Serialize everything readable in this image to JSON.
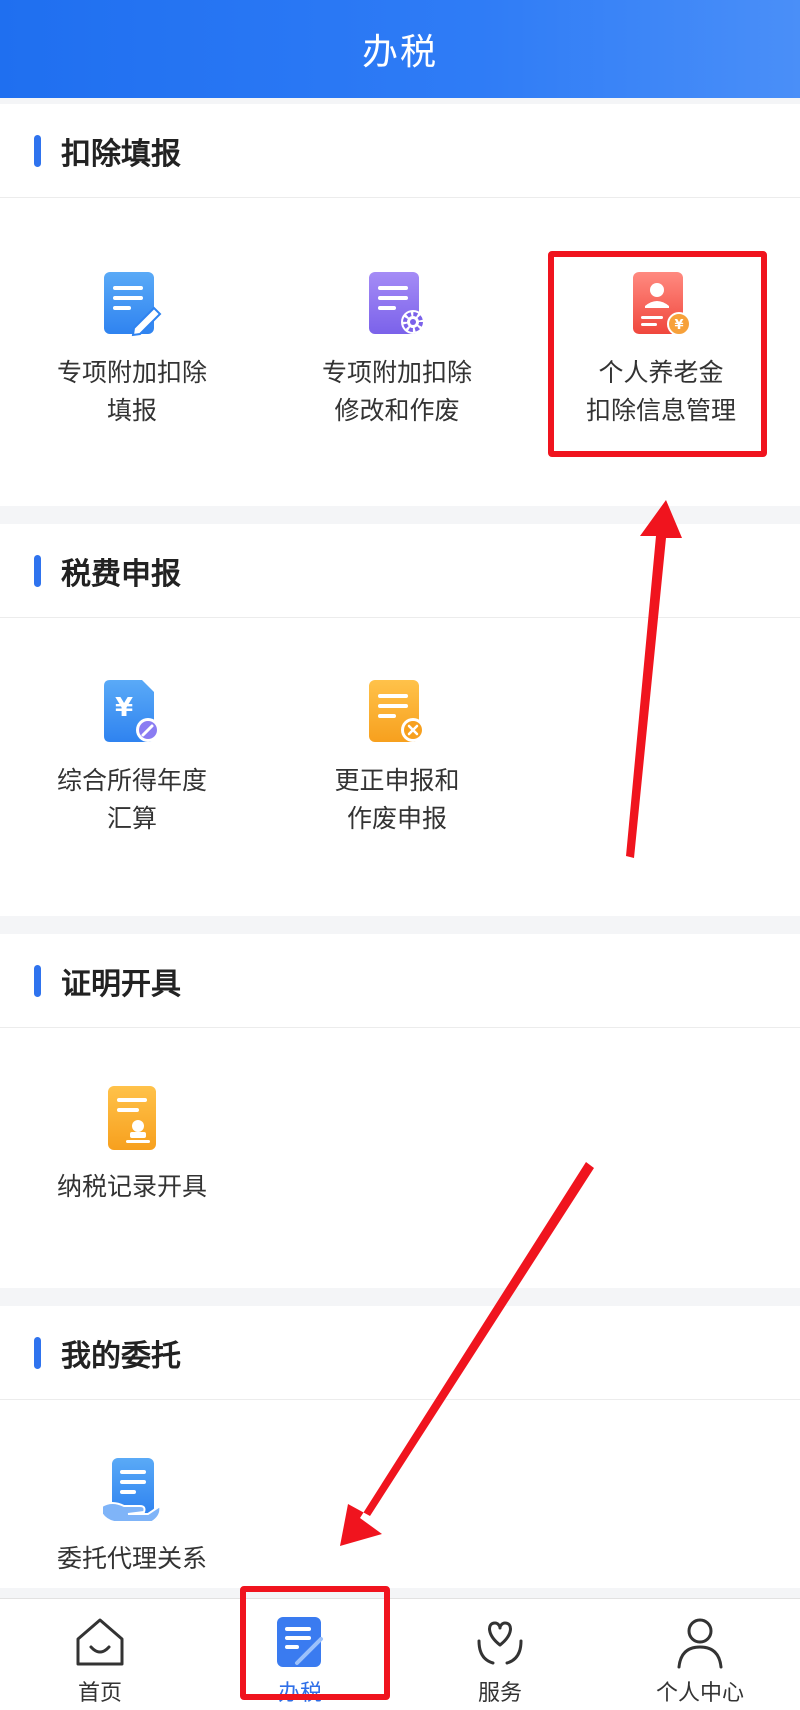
{
  "header": {
    "title": "办税"
  },
  "sections": [
    {
      "title": "扣除填报",
      "items": [
        {
          "label": "专项附加扣除\n填报",
          "icon": "doc-edit-icon"
        },
        {
          "label": "专项附加扣除\n修改和作废",
          "icon": "doc-gear-icon"
        },
        {
          "label": "个人养老金\n扣除信息管理",
          "icon": "pension-card-icon"
        }
      ]
    },
    {
      "title": "税费申报",
      "items": [
        {
          "label": "综合所得年度\n汇算",
          "icon": "yuan-doc-edit-icon"
        },
        {
          "label": "更正申报和\n作废申报",
          "icon": "doc-cancel-icon"
        }
      ]
    },
    {
      "title": "证明开具",
      "items": [
        {
          "label": "纳税记录开具",
          "icon": "certificate-stamp-icon"
        }
      ]
    },
    {
      "title": "我的委托",
      "items": [
        {
          "label": "委托代理关系",
          "icon": "doc-hand-icon"
        }
      ]
    }
  ],
  "tabbar": {
    "items": [
      {
        "label": "首页",
        "icon": "home-icon"
      },
      {
        "label": "办税",
        "icon": "tax-doc-icon"
      },
      {
        "label": "服务",
        "icon": "heart-hands-icon"
      },
      {
        "label": "个人中心",
        "icon": "person-icon"
      }
    ],
    "active_index": 1
  },
  "colors": {
    "header_blue": "#2f7cf6",
    "accent_red": "#f0141e",
    "tab_active": "#2f6fe8"
  }
}
